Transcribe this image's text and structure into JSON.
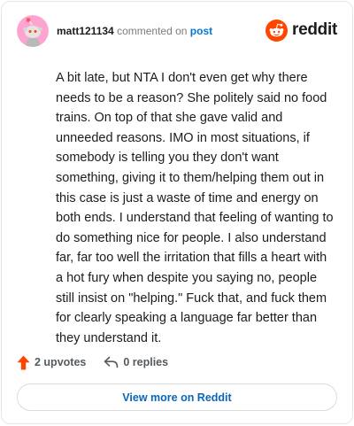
{
  "header": {
    "username": "matt121134",
    "commented_on_text": "commented on",
    "post_link_label": "post",
    "brand_name": "reddit",
    "avatar_icon": "snoo-avatar-icon",
    "brand_icon": "reddit-logo-icon"
  },
  "comment": {
    "body": "A bit late, but NTA I don't even get why there needs to be a reason? She politely said no food trains. On top of that she gave valid and unneeded reasons. IMO in most situations, if somebody is telling you they don't want something, giving it to them/helping them out in this case is just a waste of time and energy on both ends. I understand that feeling of wanting to do something nice for people. I also understand far, far too well the irritation that fills a heart with a hot fury when despite you saying no, people still insist on \"helping.\" Fuck that, and fuck them for clearly speaking a language far better than they understand it."
  },
  "actions": {
    "upvotes_label": "2 upvotes",
    "replies_label": "0 replies",
    "upvote_icon": "upvote-arrow-icon",
    "reply_icon": "reply-arrow-icon"
  },
  "footer": {
    "view_more_label": "View more on Reddit"
  },
  "colors": {
    "accent_link": "#0079d3",
    "upvote": "#ff4500",
    "avatar_bg": "#ffa3d0",
    "brand_orange": "#ff4500"
  }
}
